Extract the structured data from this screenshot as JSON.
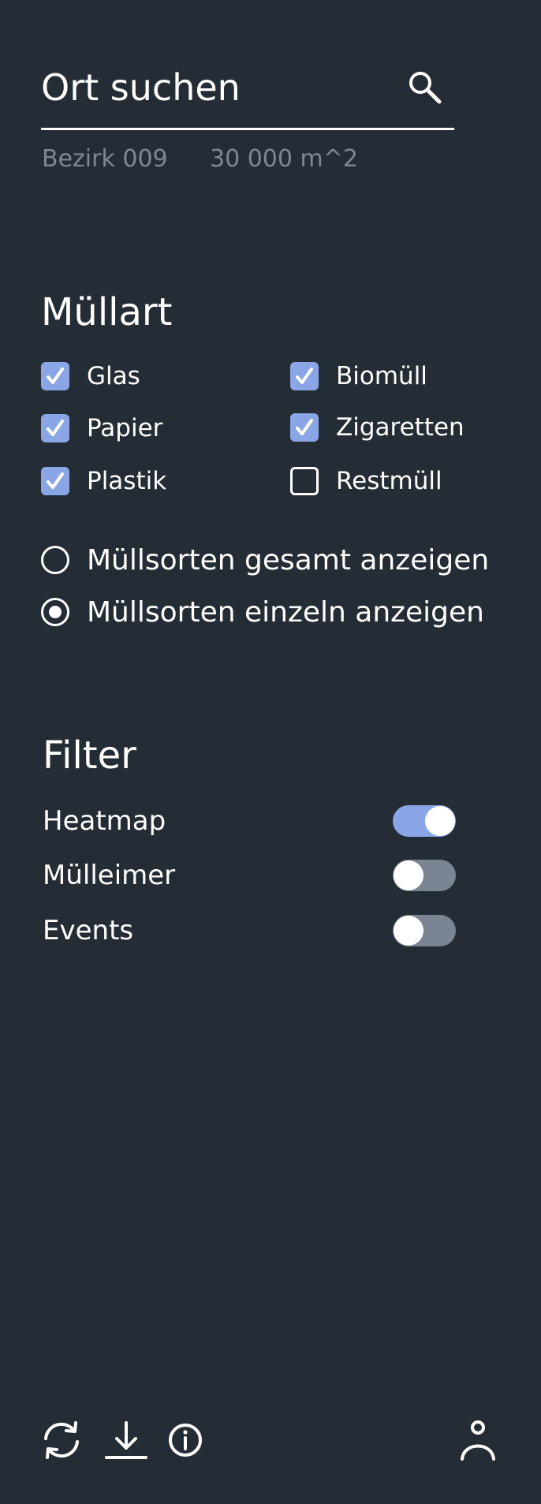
{
  "search": {
    "placeholder": "Ort suchen",
    "district": "Bezirk 009",
    "area": "30 000 m^2"
  },
  "waste_types": {
    "title": "Müllart",
    "items": [
      {
        "label": "Glas",
        "checked": true
      },
      {
        "label": "Papier",
        "checked": true
      },
      {
        "label": "Plastik",
        "checked": true
      },
      {
        "label": "Biomüll",
        "checked": true
      },
      {
        "label": "Zigaretten",
        "checked": true
      },
      {
        "label": "Restmüll",
        "checked": false
      }
    ],
    "display_modes": [
      {
        "label": "Müllsorten gesamt anzeigen",
        "selected": false
      },
      {
        "label": "Müllsorten einzeln anzeigen",
        "selected": true
      }
    ]
  },
  "filter": {
    "title": "Filter",
    "items": [
      {
        "label": "Heatmap",
        "on": true
      },
      {
        "label": "Mülleimer",
        "on": false
      },
      {
        "label": "Events",
        "on": false
      }
    ]
  },
  "toolbar": {
    "icons": [
      "refresh-icon",
      "download-icon",
      "info-icon",
      "user-icon"
    ]
  },
  "colors": {
    "background": "#242d36",
    "accent": "#8aa6e6",
    "toggle_off": "#7b8493",
    "muted_text": "#7f8791",
    "foreground": "#ffffff"
  }
}
